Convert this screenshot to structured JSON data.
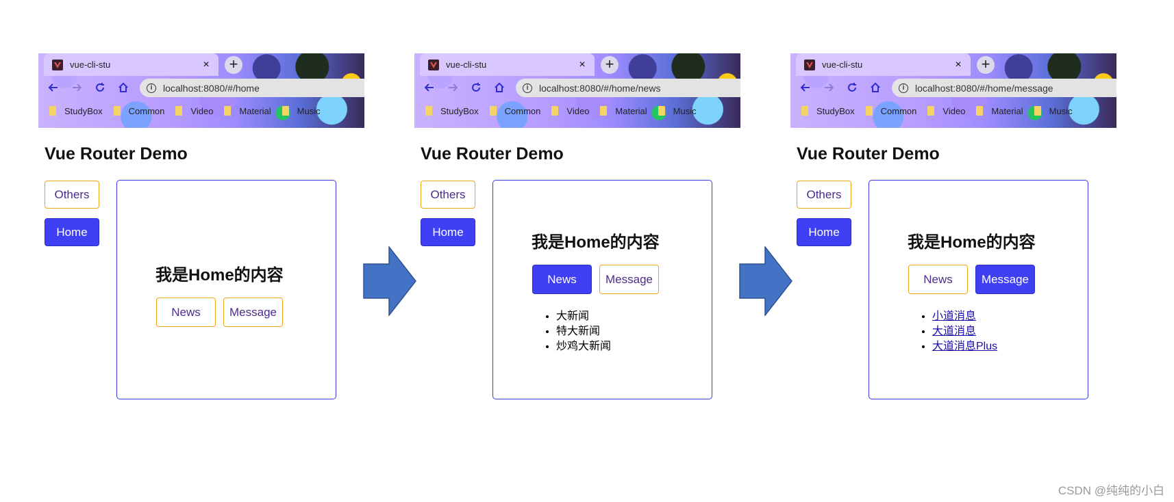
{
  "browser": {
    "tab_title": "vue-cli-stu",
    "tab_close": "×",
    "newtab": "+",
    "bookmarks": [
      "StudyBox",
      "Common",
      "Video",
      "Material",
      "Music"
    ]
  },
  "panels": [
    {
      "url": "localhost:8080/#/home",
      "app_title": "Vue Router Demo",
      "nav_others": "Others",
      "nav_home": "Home",
      "content_title": "我是Home的内容",
      "btn_news": "News",
      "btn_message": "Message",
      "active_subroute": "none",
      "list": []
    },
    {
      "url": "localhost:8080/#/home/news",
      "app_title": "Vue Router Demo",
      "nav_others": "Others",
      "nav_home": "Home",
      "content_title": "我是Home的内容",
      "btn_news": "News",
      "btn_message": "Message",
      "active_subroute": "news",
      "list": [
        "大新闻",
        "特大新闻",
        "炒鸡大新闻"
      ]
    },
    {
      "url": "localhost:8080/#/home/message",
      "app_title": "Vue Router Demo",
      "nav_others": "Others",
      "nav_home": "Home",
      "content_title": "我是Home的内容",
      "btn_news": "News",
      "btn_message": "Message",
      "active_subroute": "message",
      "list": [
        "小道消息",
        "大道消息",
        "大道消息Plus"
      ]
    }
  ],
  "watermark": "CSDN @纯纯的小白",
  "colors": {
    "active_button": "#3f3ff4",
    "outline_border": "#f0a41a",
    "content_border": "#3a3ae0",
    "arrow_fill": "#4472c4",
    "link": "#1a0dab"
  }
}
